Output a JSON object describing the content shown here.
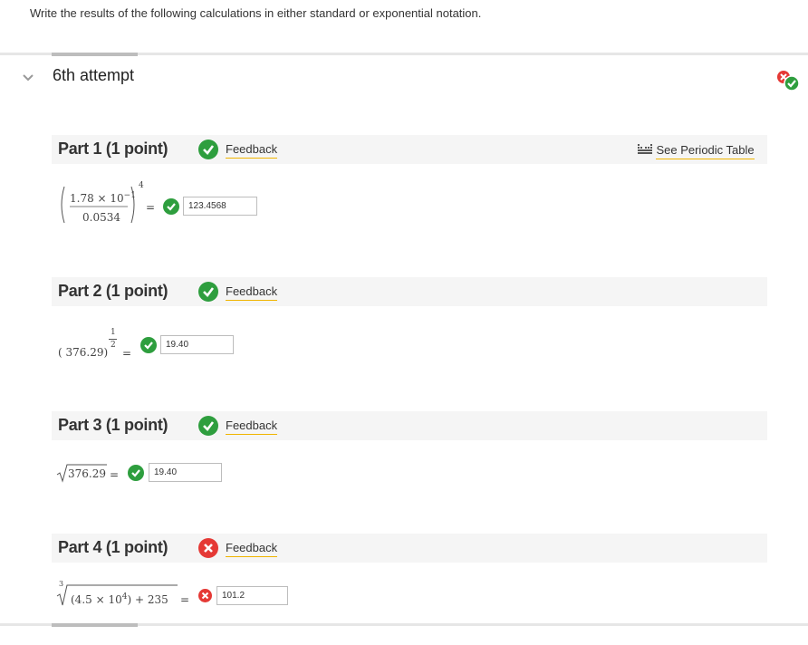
{
  "question": "Write the results of the following calculations in either standard or exponential notation.",
  "attempt_label": "6th attempt",
  "periodic_table_label": "See Periodic Table",
  "feedback_label": "Feedback",
  "colors": {
    "correct": "#2e9e3e",
    "incorrect": "#e53935",
    "link_underline": "#f0b400"
  },
  "parts": [
    {
      "title": "Part 1  (1 point)",
      "status": "correct",
      "numerator": "1.78 × 10",
      "numerator_exp": "−1",
      "denominator": "0.0534",
      "outer_exp": "4",
      "equals": "=",
      "answer": "123.4568"
    },
    {
      "title": "Part 2  (1 point)",
      "status": "correct",
      "base": "( 376.29)",
      "exp_num": "1",
      "exp_den": "2",
      "equals": "=",
      "answer": "19.40"
    },
    {
      "title": "Part 3  (1 point)",
      "status": "correct",
      "radicand": "376.29",
      "equals": "=",
      "answer": "19.40"
    },
    {
      "title": "Part 4  (1 point)",
      "status": "incorrect",
      "root_index": "3",
      "radicand_a": "(4.5  ×  10",
      "radicand_a_exp": "4",
      "radicand_b": ") +  235",
      "equals": "=",
      "answer": "101.2"
    }
  ]
}
